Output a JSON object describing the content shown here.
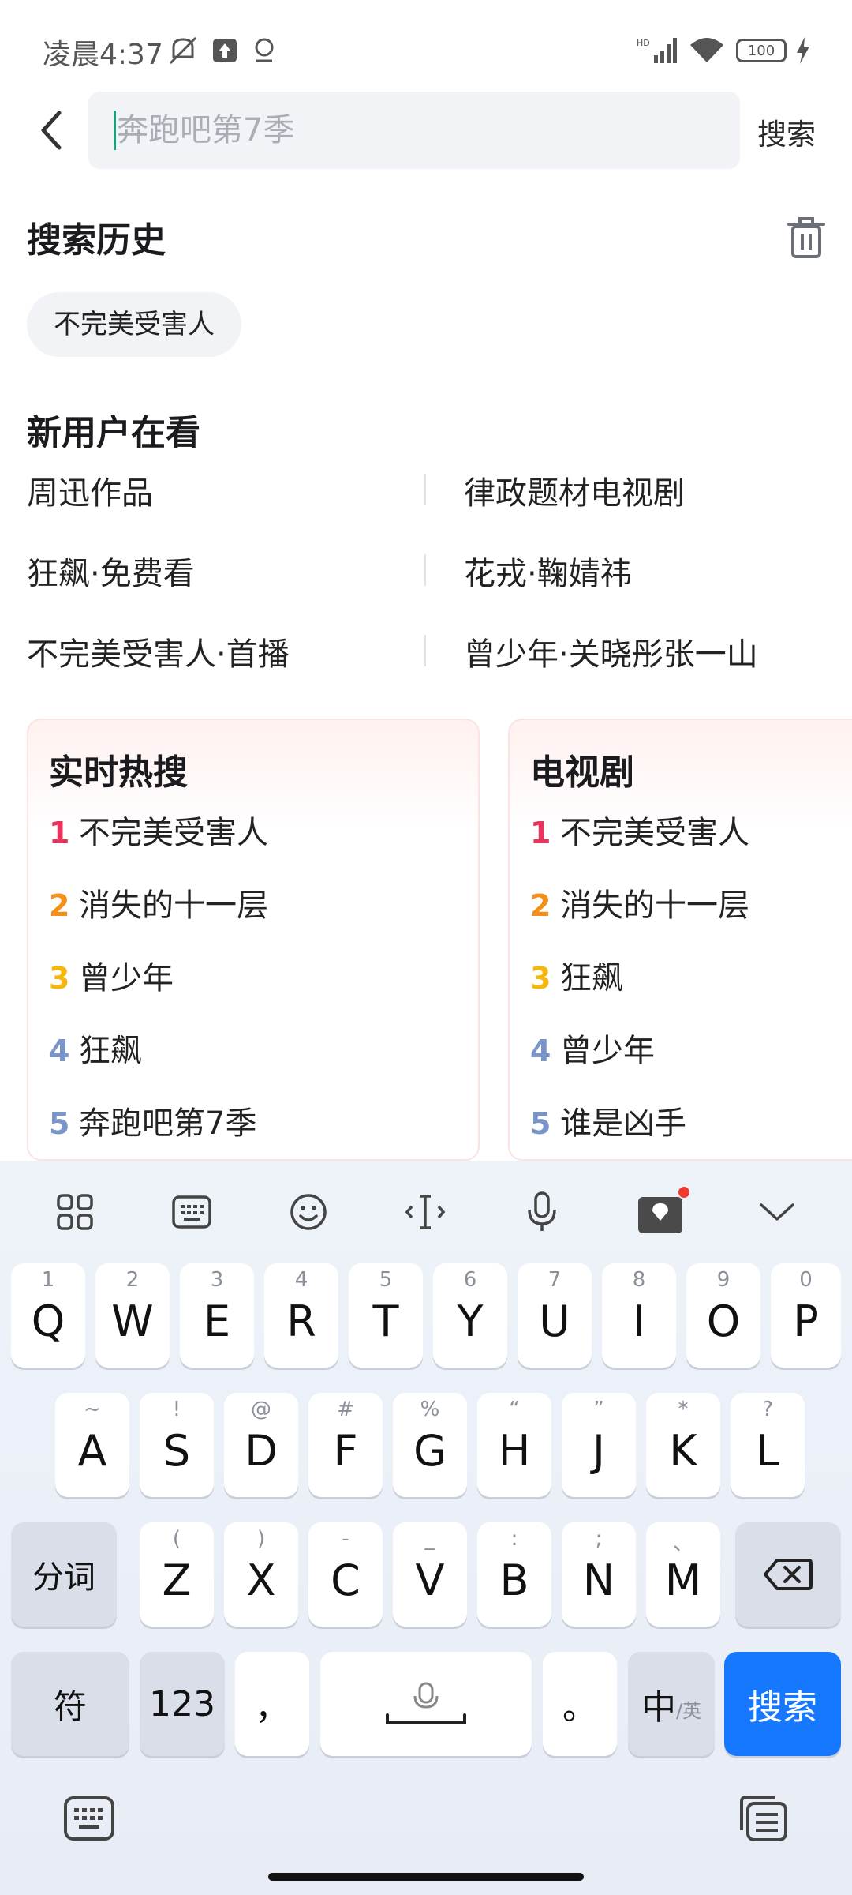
{
  "status_bar": {
    "time": "凌晨4:37",
    "battery": "100",
    "icons": [
      "mute-icon",
      "upload-icon",
      "location-icon",
      "hd-signal-icon",
      "wifi-icon",
      "battery-icon",
      "charging-icon"
    ]
  },
  "header": {
    "search_placeholder": "奔跑吧第7季",
    "search_button": "搜索"
  },
  "history": {
    "title": "搜索历史",
    "items": [
      "不完美受害人"
    ]
  },
  "new_users": {
    "title": "新用户在看",
    "items": [
      "周迅作品",
      "律政题材电视剧",
      "狂飙·免费看",
      "花戎·鞠婧祎",
      "不完美受害人·首播",
      "曾少年·关晓彤张一山"
    ]
  },
  "rank_cards": [
    {
      "title": "实时热搜",
      "items": [
        {
          "num": "1",
          "text": "不完美受害人"
        },
        {
          "num": "2",
          "text": "消失的十一层"
        },
        {
          "num": "3",
          "text": "曾少年"
        },
        {
          "num": "4",
          "text": "狂飙"
        },
        {
          "num": "5",
          "text": "奔跑吧第7季"
        }
      ]
    },
    {
      "title": "电视剧",
      "items": [
        {
          "num": "1",
          "text": "不完美受害人"
        },
        {
          "num": "2",
          "text": "消失的十一层"
        },
        {
          "num": "3",
          "text": "狂飙"
        },
        {
          "num": "4",
          "text": "曾少年"
        },
        {
          "num": "5",
          "text": "谁是凶手"
        }
      ]
    }
  ],
  "rank_colors": {
    "1": "#e8335d",
    "2": "#f39019",
    "3": "#f5b70f",
    "4": "#7a95c9",
    "5": "#7a95c9"
  },
  "keyboard": {
    "row1": [
      {
        "hint": "1",
        "key": "Q"
      },
      {
        "hint": "2",
        "key": "W"
      },
      {
        "hint": "3",
        "key": "E"
      },
      {
        "hint": "4",
        "key": "R"
      },
      {
        "hint": "5",
        "key": "T"
      },
      {
        "hint": "6",
        "key": "Y"
      },
      {
        "hint": "7",
        "key": "U"
      },
      {
        "hint": "8",
        "key": "I"
      },
      {
        "hint": "9",
        "key": "O"
      },
      {
        "hint": "0",
        "key": "P"
      }
    ],
    "row2": [
      {
        "hint": "~",
        "key": "A"
      },
      {
        "hint": "!",
        "key": "S"
      },
      {
        "hint": "@",
        "key": "D"
      },
      {
        "hint": "#",
        "key": "F"
      },
      {
        "hint": "%",
        "key": "G"
      },
      {
        "hint": "“",
        "key": "H"
      },
      {
        "hint": "”",
        "key": "J"
      },
      {
        "hint": "*",
        "key": "K"
      },
      {
        "hint": "?",
        "key": "L"
      }
    ],
    "row3_left": "分词",
    "row3": [
      {
        "hint": "(",
        "key": "Z"
      },
      {
        "hint": ")",
        "key": "X"
      },
      {
        "hint": "-",
        "key": "C"
      },
      {
        "hint": "_",
        "key": "V"
      },
      {
        "hint": ":",
        "key": "B"
      },
      {
        "hint": ";",
        "key": "N"
      },
      {
        "hint": "、",
        "key": "M"
      }
    ],
    "symbol_key": "符",
    "num_key": "123",
    "comma_key": "，",
    "period_key": "。",
    "lang_key_main": "中",
    "lang_key_alt": "/英",
    "search_key": "搜索",
    "accent": "#1677ff"
  }
}
